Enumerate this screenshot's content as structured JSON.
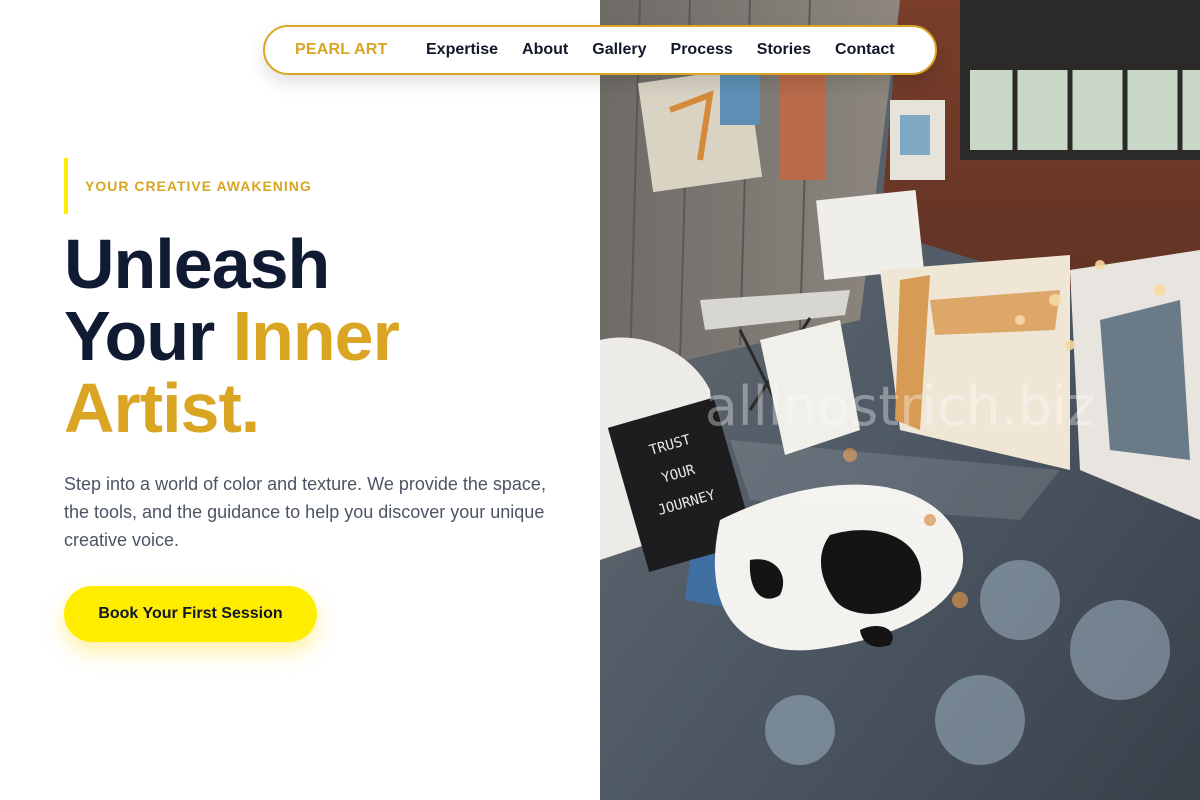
{
  "nav": {
    "brand": "PEARL ART",
    "links": [
      "Expertise",
      "About",
      "Gallery",
      "Process",
      "Stories",
      "Contact"
    ]
  },
  "hero": {
    "eyebrow": "YOUR CREATIVE AWAKENING",
    "headline_word1": "Unleash",
    "headline_word2": "Your",
    "headline_word3": "Inner",
    "headline_word4": "Artist",
    "headline_period": ".",
    "lead": "Step into a world of color and texture. We provide the space, the tools, and the guidance to help you discover your unique creative voice.",
    "cta_label": "Book Your First Session"
  },
  "image": {
    "sign_text": [
      "TRUST",
      "YOUR",
      "JOURNEY"
    ],
    "watermark": "allinostrich.biz"
  },
  "colors": {
    "accent_gold": "#d9a523",
    "cta_yellow": "#ffed00",
    "heading_navy": "#111a33",
    "body_gray": "#4b5563"
  }
}
